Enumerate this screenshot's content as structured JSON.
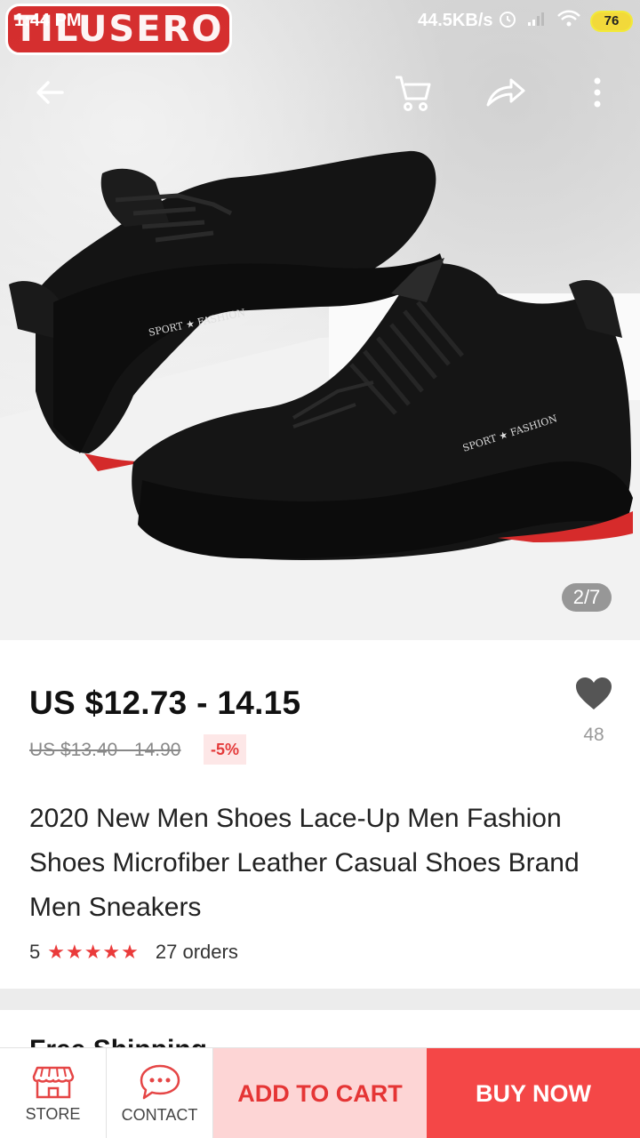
{
  "status_bar": {
    "time": "1:44 PM",
    "network_speed": "44.5KB/s",
    "battery": "76"
  },
  "brand": {
    "watermark": "TILUSERO"
  },
  "top_bar": {
    "back_icon": "arrow-left-icon",
    "cart_icon": "cart-icon",
    "share_icon": "share-icon",
    "more_icon": "more-vertical-icon"
  },
  "gallery": {
    "counter": "2/7",
    "shoe_print": "SPORT ★ FASHION"
  },
  "product": {
    "price": "US $12.73 - 14.15",
    "original_price": "US $13.40 - 14.90",
    "discount": "-5%",
    "wishlist_count": "48",
    "title": "2020 New Men Shoes Lace-Up Men Fashion Shoes Microfiber Leather Casual Shoes Brand Men Sneakers",
    "rating_value": "5",
    "rating_stars": "★★★★★",
    "orders": "27 orders"
  },
  "shipping": {
    "title": "Free Shipping"
  },
  "bottom_bar": {
    "store_label": "STORE",
    "contact_label": "CONTACT",
    "add_to_cart_label": "ADD TO CART",
    "buy_now_label": "BUY NOW"
  },
  "colors": {
    "accent_red": "#f44747",
    "add_cart_bg": "#fdd5d5",
    "star_red": "#ea3a3a"
  }
}
